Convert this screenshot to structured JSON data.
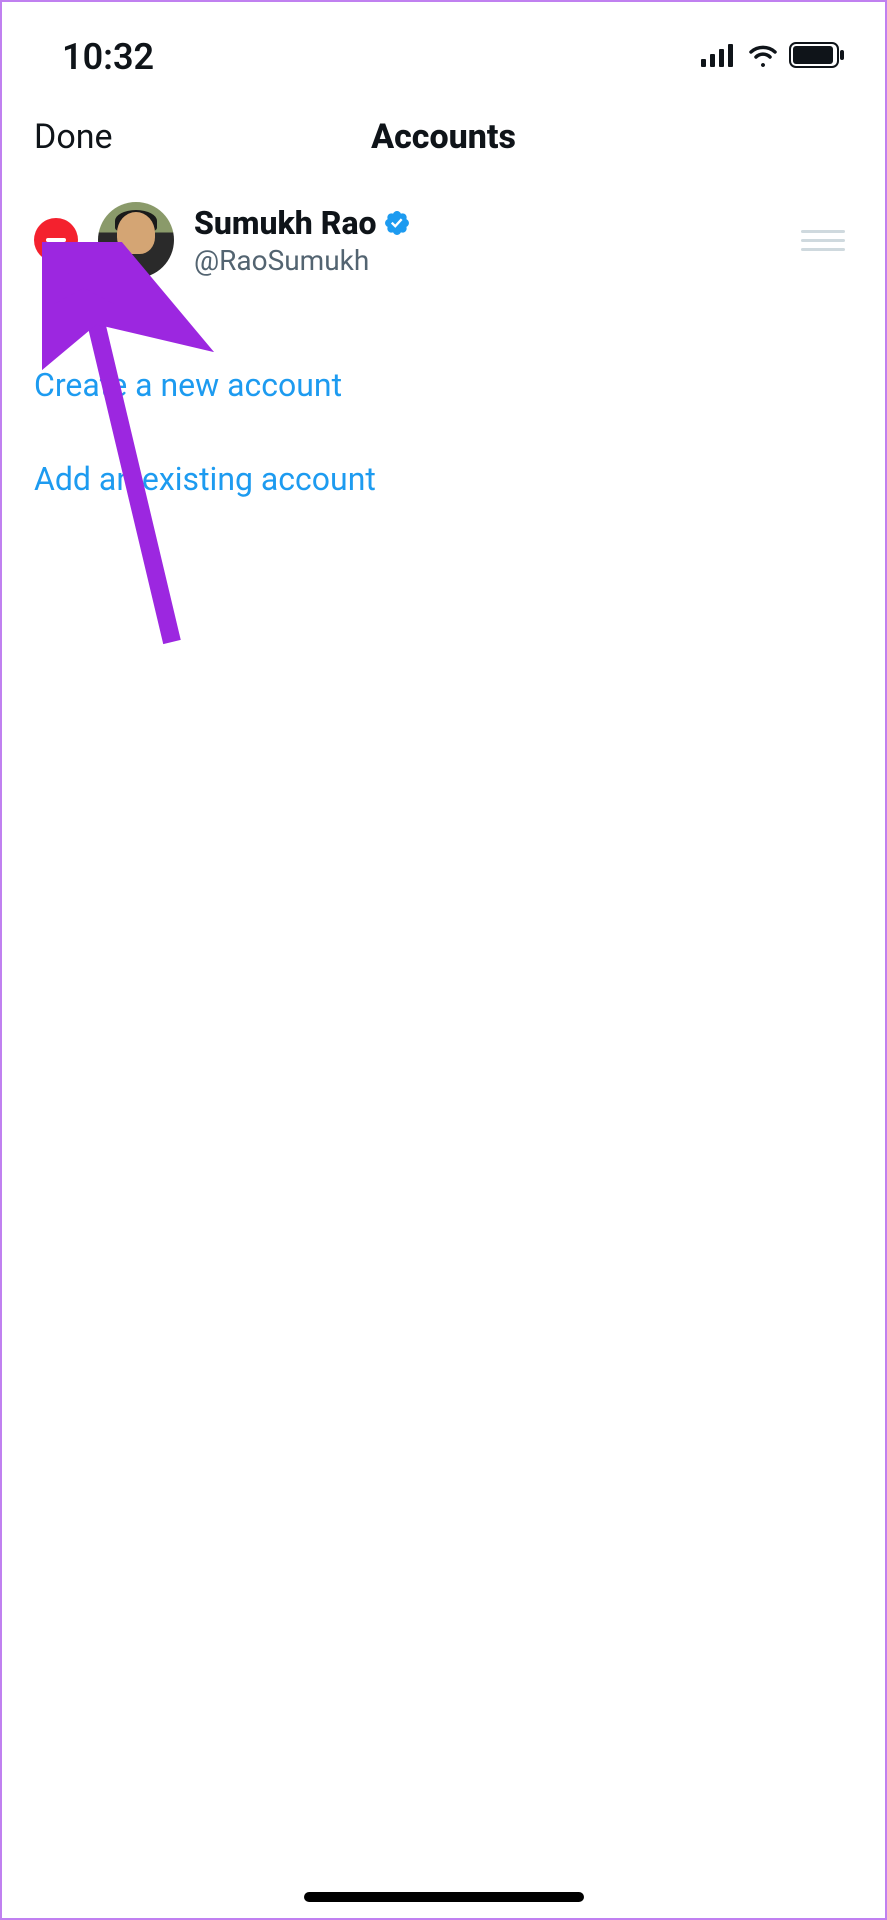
{
  "status_bar": {
    "time": "10:32"
  },
  "nav": {
    "done_label": "Done",
    "title": "Accounts"
  },
  "account": {
    "display_name": "Sumukh Rao",
    "handle": "@RaoSumukh",
    "verified": true
  },
  "links": {
    "create_account": "Create a new account",
    "add_existing": "Add an existing account"
  },
  "colors": {
    "link": "#1d9bf0",
    "delete": "#f4212e",
    "text": "#0f1419",
    "secondary": "#536471"
  }
}
